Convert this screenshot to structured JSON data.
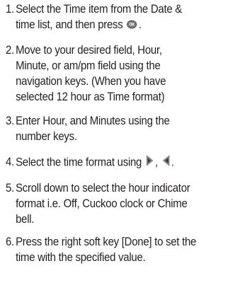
{
  "steps": [
    {
      "number": "1.",
      "lines": [
        "Select the Time item from the Date &",
        "time list, and then press",
        "."
      ],
      "icon": "ok-key-icon"
    },
    {
      "number": "2.",
      "lines": [
        "Move to your desired field, Hour,",
        "Minute, or am/pm field using the",
        "navigation keys. (When you have",
        "selected 12 hour as Time format)"
      ]
    },
    {
      "number": "3.",
      "lines": [
        "Enter Hour, and Minutes using the",
        "number keys."
      ]
    },
    {
      "number": "4.",
      "lines": [
        "Select the time format using",
        ",",
        "."
      ],
      "icons": [
        "right-nav-key-icon",
        "left-nav-key-icon"
      ]
    },
    {
      "number": "5.",
      "lines": [
        "Scroll down to select the hour indicator",
        "format i.e. Off, Cuckoo clock or Chime",
        "bell."
      ]
    },
    {
      "number": "6.",
      "lines": [
        "Press the right soft key [Done] to set the",
        "time with the specified value."
      ]
    }
  ]
}
